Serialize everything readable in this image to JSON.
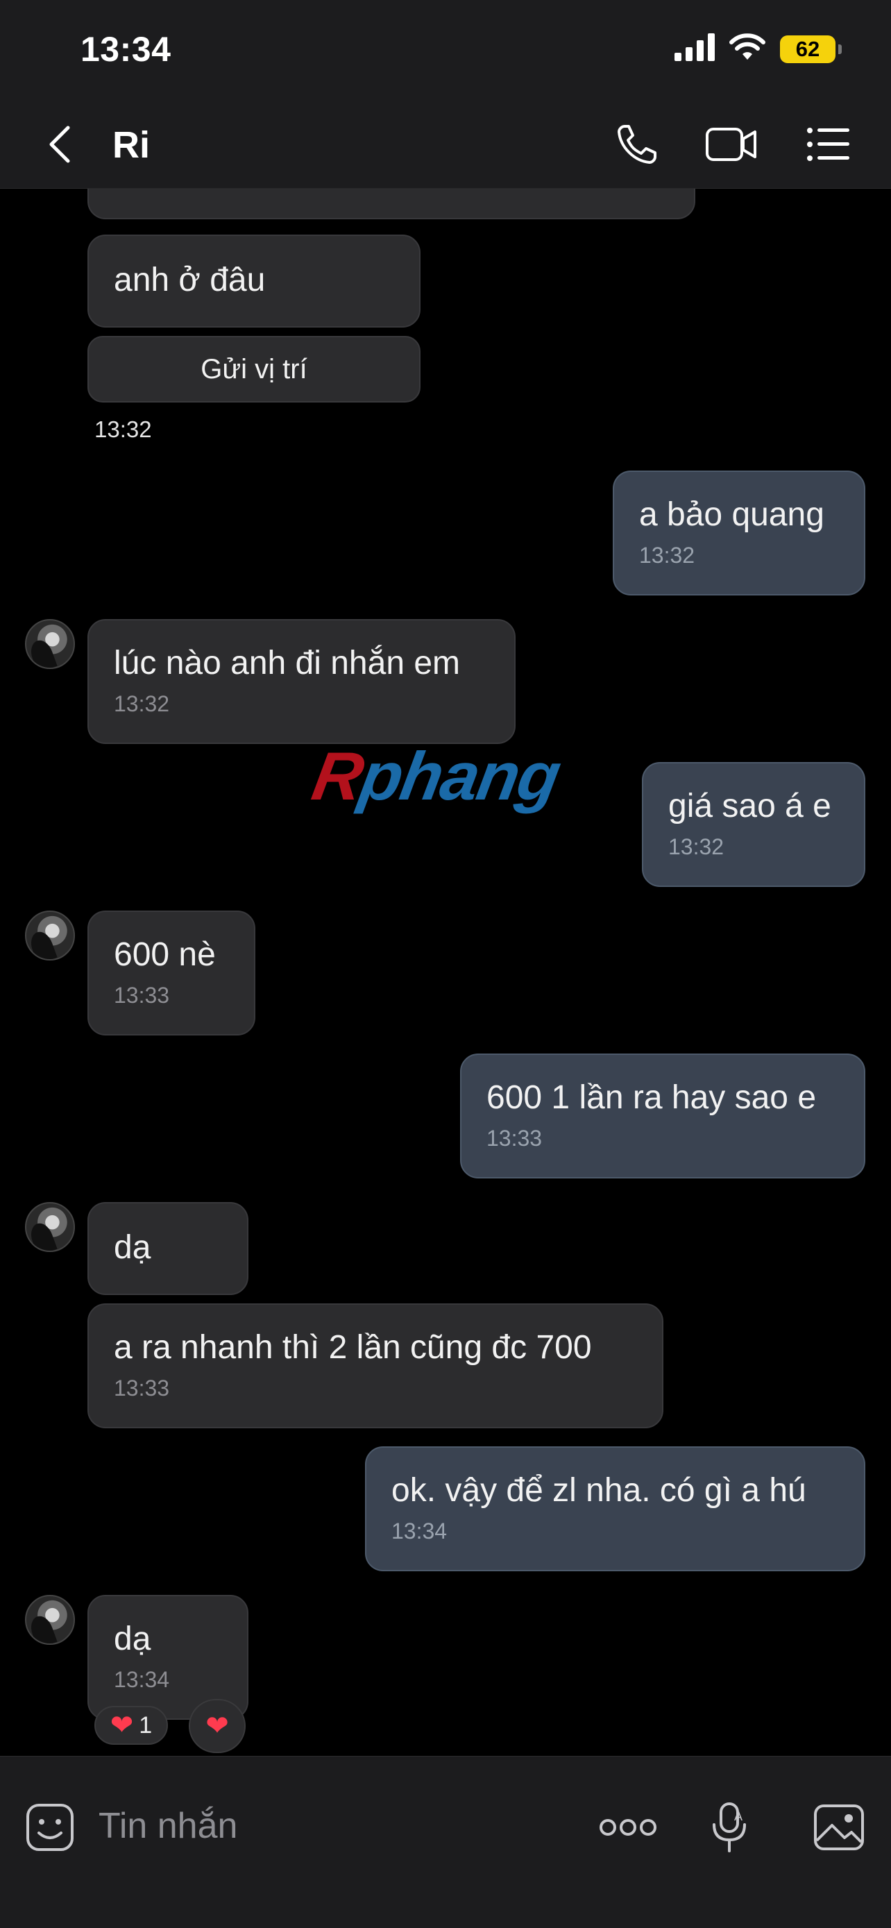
{
  "status_bar": {
    "time": "13:34",
    "battery": "62"
  },
  "header": {
    "contact_name": "Ri"
  },
  "messages": [
    {
      "dir": "in",
      "text": "anh ở đâu"
    },
    {
      "dir": "in",
      "location_button": "Gửi vị trí",
      "time": "13:32"
    },
    {
      "dir": "out",
      "text": "a bảo quang",
      "time": "13:32"
    },
    {
      "dir": "in",
      "text": "lúc nào anh đi nhắn em",
      "time": "13:32"
    },
    {
      "dir": "out",
      "text": "giá sao á e",
      "time": "13:32"
    },
    {
      "dir": "in",
      "text": "600 nè",
      "time": "13:33"
    },
    {
      "dir": "out",
      "text": "600 1 lần ra hay sao e",
      "time": "13:33"
    },
    {
      "dir": "in",
      "text": "dạ"
    },
    {
      "dir": "in",
      "text": "a ra nhanh thì 2 lần cũng đc 700",
      "time": "13:33"
    },
    {
      "dir": "out",
      "text": "ok. vậy để zl nha. có gì a hú",
      "time": "13:34"
    },
    {
      "dir": "in",
      "text": "dạ",
      "time": "13:34",
      "reaction_count": "1"
    }
  ],
  "watermark": {
    "part1": "R",
    "part2": "phang"
  },
  "composer": {
    "placeholder": "Tin nhắn"
  },
  "colors": {
    "bubble_in": "#2c2c2e",
    "bubble_out": "#3a4351",
    "heart": "#ff3b4f",
    "battery": "#f5d20c"
  }
}
